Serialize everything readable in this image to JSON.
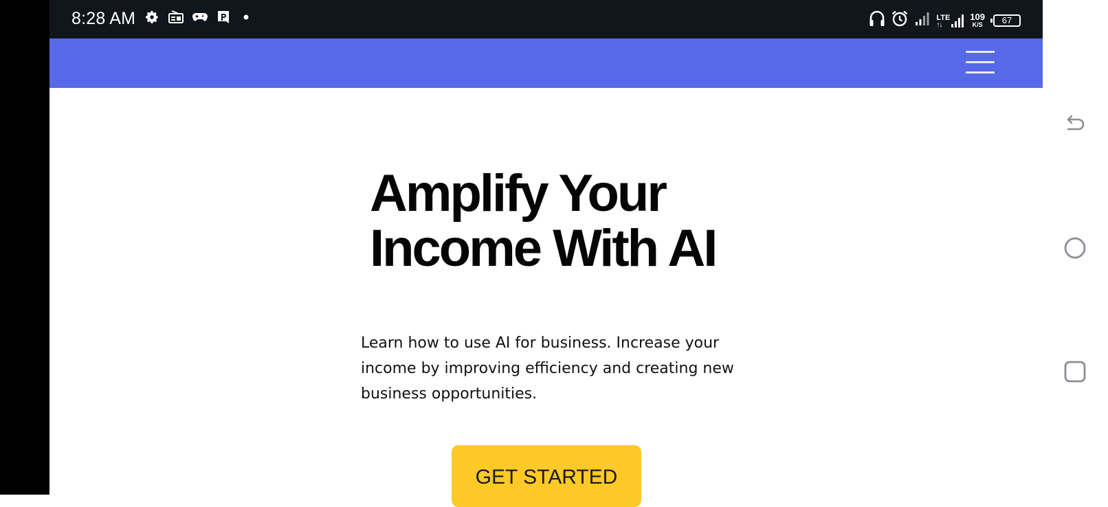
{
  "status_bar": {
    "time": "8:28 AM",
    "icons_left": [
      "settings-icon",
      "radio-icon",
      "gamepad-icon",
      "app-p-icon",
      "dot-icon"
    ],
    "icons_right": [
      "headphones-icon",
      "alarm-icon",
      "signal-icon",
      "lte-signal-icon"
    ],
    "network_type": "LTE",
    "speed_value": "109",
    "speed_unit": "K/S",
    "battery_level": "67"
  },
  "header": {
    "menu_icon": "hamburger-menu-icon",
    "background_color": "#5669e8"
  },
  "hero": {
    "title_line1": "Amplify Your",
    "title_line2": "Income With AI",
    "description_line1": "Learn how to use AI for business. Increase your",
    "description_line2": "income by improving efficiency and creating new",
    "description_line3": "business opportunities.",
    "cta_label": "GET STARTED",
    "cta_color": "#ffc928"
  },
  "system_nav": {
    "back_icon": "back-icon",
    "home_icon": "home-circle-icon",
    "recents_icon": "recents-square-icon"
  }
}
